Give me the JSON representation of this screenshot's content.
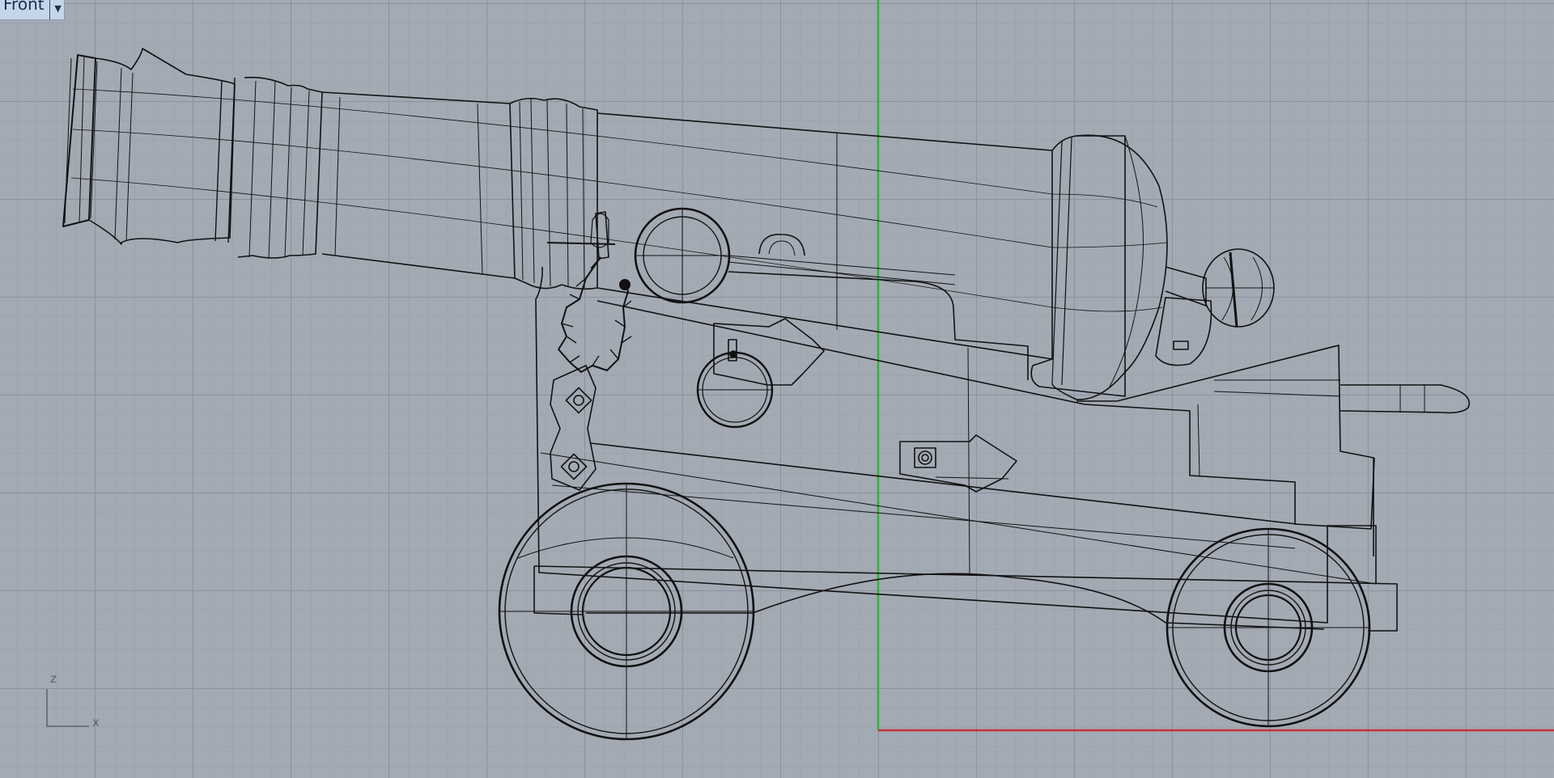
{
  "viewport": {
    "title": "Front",
    "menu_icon": "chevron-down-icon"
  },
  "gizmo": {
    "vertical_axis": "z",
    "horizontal_axis": "x"
  },
  "colors": {
    "background": "#a3aab4",
    "grid_major": "#8a929e",
    "wire": "#111111",
    "axis_x": "#c8303a",
    "axis_z": "#2fb23a",
    "title_bg": "#c5d6ea"
  }
}
